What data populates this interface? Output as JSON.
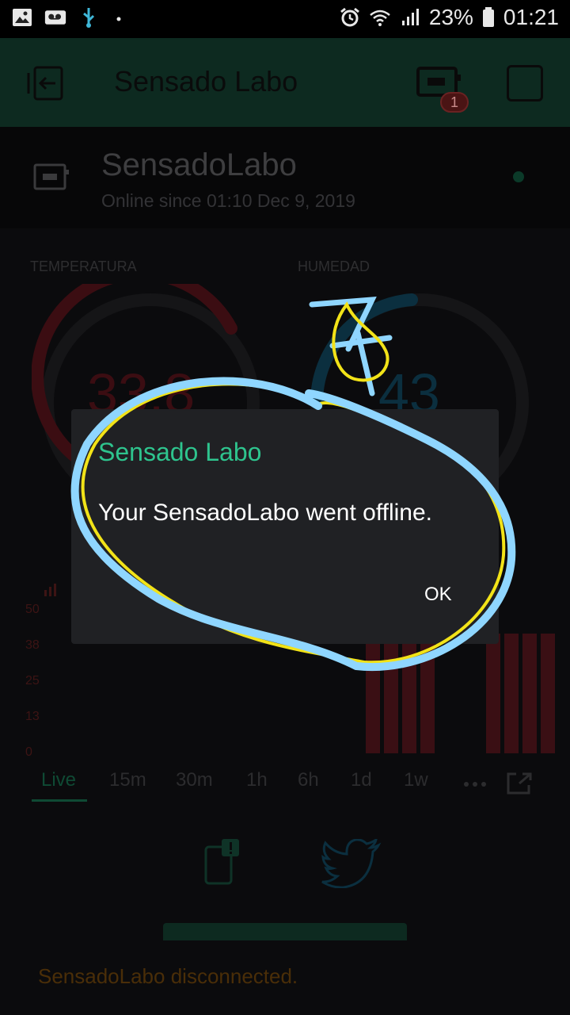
{
  "status_bar": {
    "battery": "23%",
    "time": "01:21",
    "icons": [
      "image-icon",
      "voicemail-icon",
      "usb-icon",
      "dot-icon",
      "alarm-icon",
      "wifi-icon",
      "signal-icon",
      "battery-icon"
    ]
  },
  "app_bar": {
    "title": "Sensado Labo",
    "badge_count": "1",
    "icons": [
      "exit-icon",
      "device-icon",
      "square-icon"
    ]
  },
  "device": {
    "name": "SensadoLabo",
    "status": "Online since 01:10 Dec 9, 2019"
  },
  "gauges": [
    {
      "label": "TEMPERATURA",
      "value": "33.8",
      "color": "#3b0d12"
    },
    {
      "label": "HUMEDAD",
      "value": "43",
      "color": "#0b2f3f"
    }
  ],
  "chart_data": {
    "type": "bar",
    "y_ticks": [
      "50",
      "38",
      "25",
      "13",
      "0"
    ],
    "ylim": [
      0,
      50
    ],
    "values": [
      27,
      27,
      27,
      27,
      27,
      27,
      27,
      27
    ],
    "color": "#3a0f14"
  },
  "time_tabs": [
    "Live",
    "15m",
    "30m",
    "1h",
    "6h",
    "1d",
    "1w"
  ],
  "more_icon": "more-icon",
  "expand_icon": "expand-icon",
  "footer": {
    "message": "SensadoLabo disconnected."
  },
  "dialog": {
    "title": "Sensado Labo",
    "message": "Your SensadoLabo went offline.",
    "ok_label": "OK"
  },
  "colors": {
    "accent": "#2ec48e",
    "annotation_blue": "#8fd6ff",
    "annotation_yellow": "#f2e318"
  }
}
